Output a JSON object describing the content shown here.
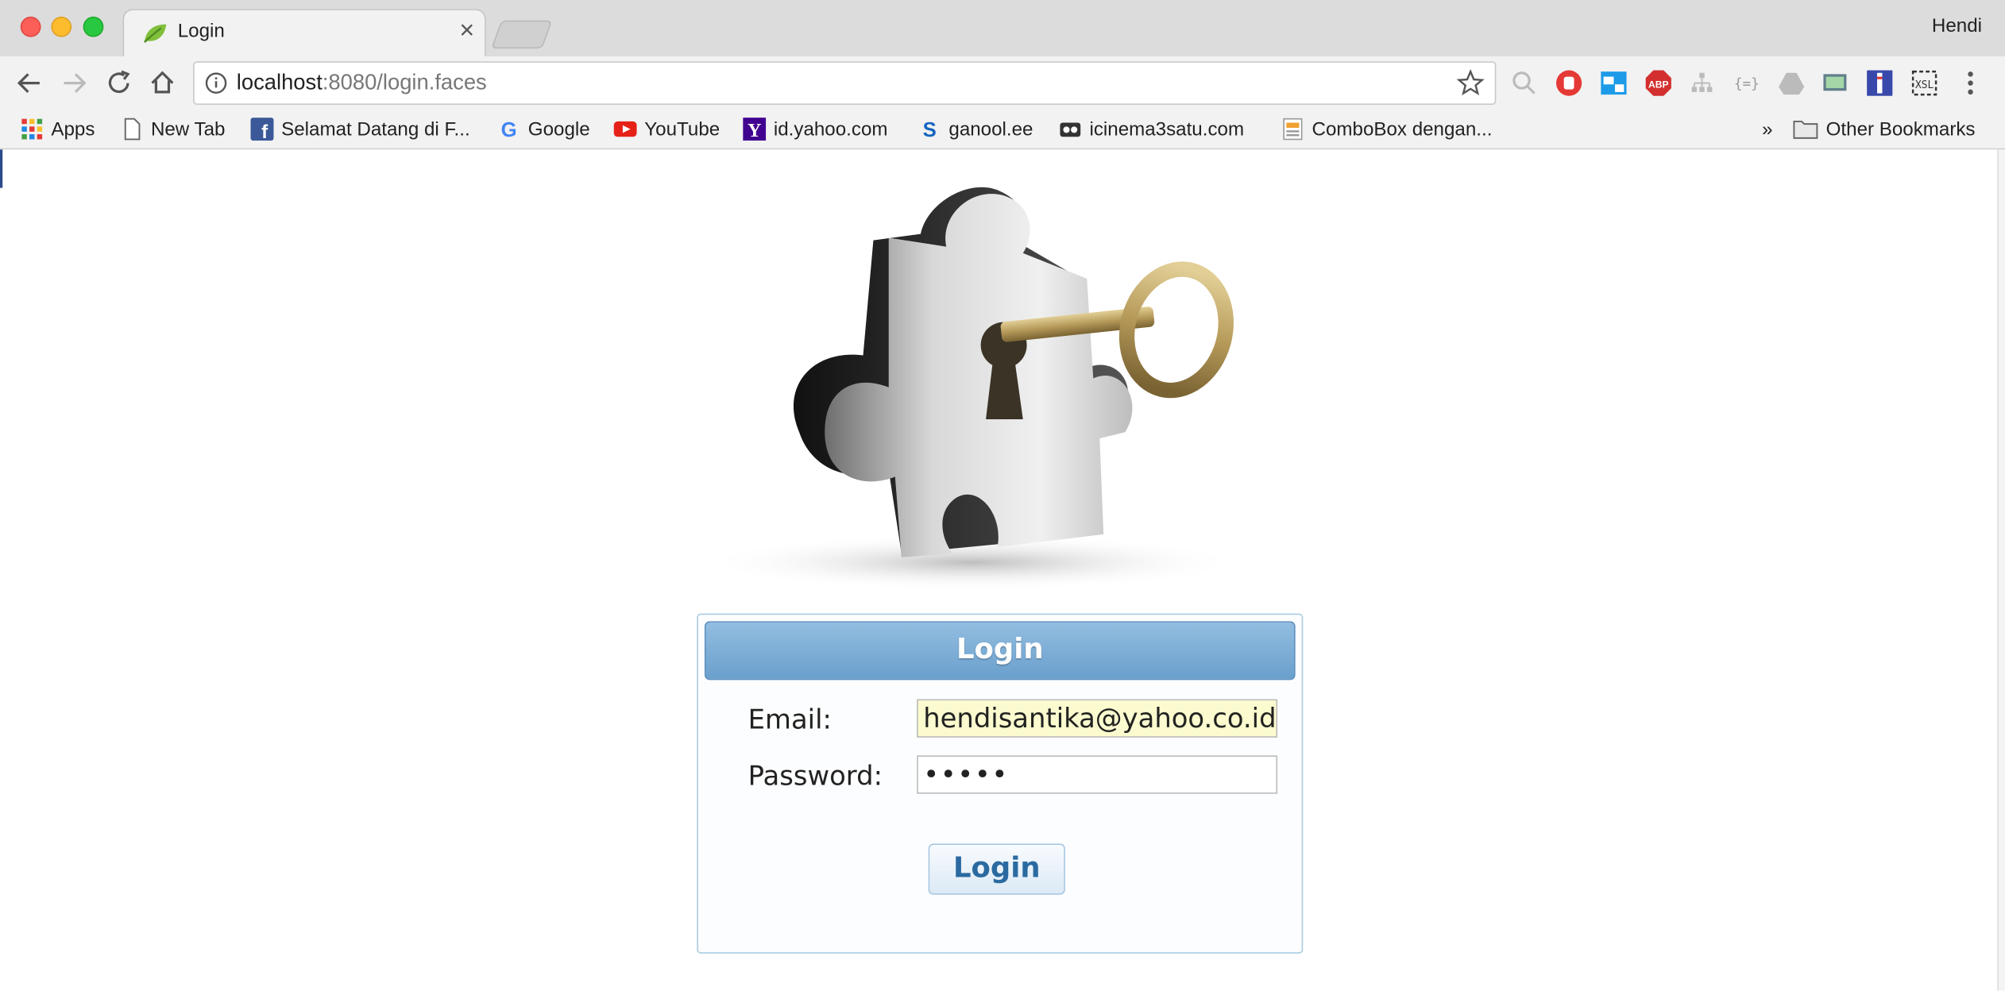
{
  "window": {
    "profile_name": "Hendi"
  },
  "tab": {
    "title": "Login",
    "close_label": "×"
  },
  "address_bar": {
    "host": "localhost",
    "path": ":8080/login.faces"
  },
  "bookmarks": [
    {
      "label": "Apps",
      "icon": "apps-grid-icon"
    },
    {
      "label": "New Tab",
      "icon": "page-icon"
    },
    {
      "label": "Selamat Datang di F...",
      "icon": "facebook-icon"
    },
    {
      "label": "Google",
      "icon": "google-icon"
    },
    {
      "label": "YouTube",
      "icon": "youtube-icon"
    },
    {
      "label": "id.yahoo.com",
      "icon": "yahoo-icon"
    },
    {
      "label": "ganool.ee",
      "icon": "ganool-icon"
    },
    {
      "label": "icinema3satu.com",
      "icon": "cinema-icon"
    },
    {
      "label": "ComboBox dengan...",
      "icon": "document-icon"
    }
  ],
  "bookmarks_overflow": "»",
  "other_bookmarks": "Other Bookmarks",
  "login_panel": {
    "header": "Login",
    "email_label": "Email:",
    "email_value": "hendisantika@yahoo.co.id",
    "password_label": "Password:",
    "password_value": "•••••",
    "submit_label": "Login"
  },
  "colors": {
    "panel_header": "#7aaad4",
    "email_bg": "#fbfbcf",
    "button_text": "#2a6aa0"
  }
}
